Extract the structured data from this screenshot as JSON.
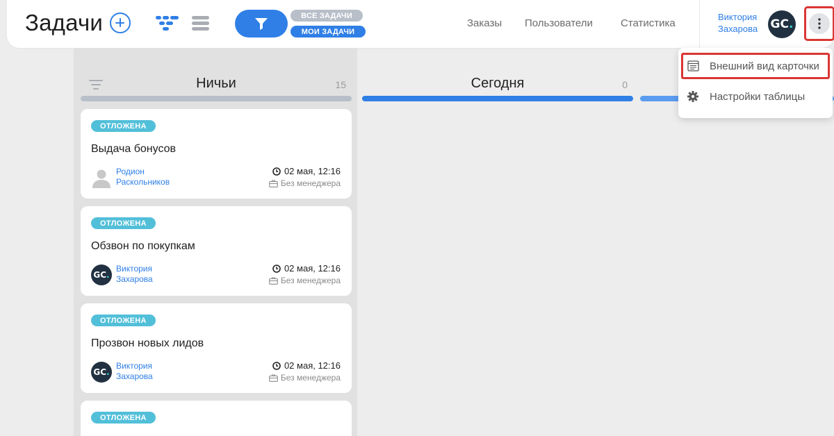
{
  "header": {
    "title": "Задачи",
    "filters": {
      "all": "ВСЕ ЗАДАЧИ",
      "mine": "МОИ ЗАДАЧИ"
    },
    "nav": {
      "orders": "Заказы",
      "users": "Пользователи",
      "stats": "Статистика"
    },
    "user": {
      "first_name": "Виктория",
      "last_name": "Захарова",
      "avatar_text": "GC",
      "avatar_dot": "."
    }
  },
  "menu": {
    "card_view": "Внешний вид карточки",
    "table_settings": "Настройки таблицы"
  },
  "columns": [
    {
      "title": "Ничьи",
      "count": "15",
      "bar_color": "#b8bfc9"
    },
    {
      "title": "Сегодня",
      "count": "0",
      "bar_color": "#2f7fe6"
    },
    {
      "title": "",
      "count": "",
      "bar_color": "#5b9cf0"
    }
  ],
  "cards": [
    {
      "status": "ОТЛОЖЕНА",
      "title": "Выдача бонусов",
      "assignee": {
        "first": "Родион",
        "last": "Раскольников",
        "avatar": "placeholder"
      },
      "due": "02 мая, 12:16",
      "manager": "Без менеджера"
    },
    {
      "status": "ОТЛОЖЕНА",
      "title": "Обзвон по покупкам",
      "assignee": {
        "first": "Виктория",
        "last": "Захарова",
        "avatar": "GC"
      },
      "due": "02 мая, 12:16",
      "manager": "Без менеджера"
    },
    {
      "status": "ОТЛОЖЕНА",
      "title": "Прозвон новых лидов",
      "assignee": {
        "first": "Виктория",
        "last": "Захарова",
        "avatar": "GC"
      },
      "due": "02 мая, 12:16",
      "manager": "Без менеджера"
    },
    {
      "status": "ОТЛОЖЕНА"
    }
  ],
  "colors": {
    "accent": "#2f7fe6",
    "status": "#52bfd9",
    "highlight": "#d93634"
  },
  "icons": [
    "add-icon",
    "kanban-view-icon",
    "list-view-icon",
    "filter-icon",
    "more-vertical-icon",
    "card-layout-icon",
    "gear-icon",
    "sort-icon",
    "clock-icon",
    "briefcase-icon",
    "user-placeholder-icon"
  ]
}
